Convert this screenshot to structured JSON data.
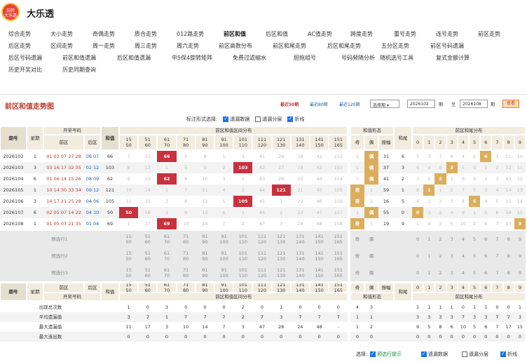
{
  "brand": {
    "logo_text": "玩转\n大乐透",
    "title": "大乐透"
  },
  "nav": [
    [
      "综合走势",
      "大小走势",
      "奇偶走势",
      "质合走势",
      "012路走势",
      "前区和值",
      "后区和值",
      "AC值走势",
      "跨度走势",
      "重号走势",
      "连号走势",
      "前区走势"
    ],
    [
      "后区走势",
      "区间走势",
      "周一走势",
      "周三走势",
      "周六走势",
      "前区高数分布",
      "前区和尾走势",
      "后区和尾走势",
      "五分区走势",
      "前区号码遗漏"
    ],
    [
      "后区号码遗漏",
      "前区和值遗漏",
      "后区和值遗漏",
      "中5保4旋转矩阵",
      "免费过滤缩水",
      "胆拖组号",
      "号码频随分析",
      "随机选号工具",
      "复式金额计算"
    ],
    [
      "历史开奖对比",
      "历史同期查询"
    ]
  ],
  "panel": {
    "title": "前区和值走势图",
    "latest50": "最近50期",
    "latest80": "最近80期",
    "latest120": "最近120期",
    "select": "选择期",
    "from": "2026102",
    "to": "2026108",
    "qi": "期",
    "zhi": "至",
    "view": "查看"
  },
  "opts": {
    "label": "标注形式选择:",
    "items": [
      "遗漏数据",
      "遗漏分层",
      "折线"
    ],
    "checked": [
      true,
      false,
      true
    ]
  },
  "header": {
    "period": "期号",
    "week": "星期",
    "draw": "开奖号码",
    "front": "前区",
    "back": "后区",
    "sum": "和值",
    "dist": "前区和值区间分布",
    "form": "和值形态",
    "odd": "奇",
    "even": "偶",
    "swing": "振幅",
    "tail": "和尾",
    "taildist": "前区和尾分布"
  },
  "ranges": [
    [
      "15",
      "50"
    ],
    [
      "51",
      "60"
    ],
    [
      "61",
      "70"
    ],
    [
      "71",
      "80"
    ],
    [
      "81",
      "90"
    ],
    [
      "91",
      "100"
    ],
    [
      "101",
      "110"
    ],
    [
      "111",
      "120"
    ],
    [
      "121",
      "130"
    ],
    [
      "131",
      "140"
    ],
    [
      "141",
      "150"
    ],
    [
      "151",
      "165"
    ]
  ],
  "tails": [
    "0",
    "1",
    "2",
    "3",
    "4",
    "5",
    "6",
    "7",
    "8",
    "9"
  ],
  "rows": [
    {
      "period": "2026102",
      "week": "1",
      "front": "01 03 07 27 28",
      "back": "06 07",
      "sum": "66",
      "dist": [
        "7",
        "11",
        "66",
        "4",
        "8",
        "1",
        "3",
        "41",
        "26",
        "18",
        "42",
        "152"
      ],
      "hit": 2,
      "odd": "1",
      "even": "偶",
      "oddhit": false,
      "swing": "31",
      "tail": "6",
      "tails": [
        "5",
        "3",
        "7",
        "6",
        "4",
        "2",
        "6",
        "1",
        "11",
        "10"
      ],
      "thit": 6
    },
    {
      "period": "2026103",
      "week": "3",
      "front": "03 16 17 32 35",
      "back": "02 12",
      "sum": "103",
      "dist": [
        "8",
        "12",
        "1",
        "5",
        "9",
        "2",
        "103",
        "42",
        "27",
        "19",
        "43",
        "153"
      ],
      "hit": 6,
      "odd": "1",
      "even": "偶",
      "oddhit": false,
      "swing": "37",
      "tail": "3",
      "tails": [
        "6",
        "4",
        "8",
        "3",
        "5",
        "3",
        "1",
        "2",
        "12",
        "11"
      ],
      "thit": 3
    },
    {
      "period": "2026104",
      "week": "6",
      "front": "01 06 14 15 26",
      "back": "08 09",
      "sum": "62",
      "dist": [
        "9",
        "13",
        "62",
        "6",
        "10",
        "3",
        "1",
        "43",
        "28",
        "20",
        "44",
        "154"
      ],
      "hit": 2,
      "odd": "1",
      "even": "偶",
      "oddhit": false,
      "swing": "41",
      "tail": "2",
      "tails": [
        "7",
        "5",
        "2",
        "1",
        "6",
        "4",
        "2",
        "3",
        "13",
        "12"
      ],
      "thit": 2
    },
    {
      "period": "2026105",
      "week": "1",
      "front": "10 14 30 33 34",
      "back": "09 12",
      "sum": "121",
      "dist": [
        "10",
        "14",
        "1",
        "7",
        "11",
        "4",
        "2",
        "44",
        "121",
        "21",
        "45",
        "155"
      ],
      "hit": 8,
      "odd": "奇",
      "even": "1",
      "oddhit": true,
      "swing": "59",
      "tail": "1",
      "tails": [
        "8",
        "1",
        "1",
        "2",
        "7",
        "5",
        "3",
        "4",
        "14",
        "13"
      ],
      "thit": 1
    },
    {
      "period": "2026106",
      "week": "3",
      "front": "14 17 21 25 28",
      "back": "04 06",
      "sum": "105",
      "dist": [
        "11",
        "15",
        "2",
        "8",
        "12",
        "5",
        "105",
        "45",
        "1",
        "22",
        "46",
        "156"
      ],
      "hit": 6,
      "odd": "奇",
      "even": "2",
      "oddhit": true,
      "swing": "16",
      "tail": "5",
      "tails": [
        "9",
        "2",
        "2",
        "3",
        "8",
        "5",
        "4",
        "5",
        "15",
        "14"
      ],
      "thit": 5
    },
    {
      "period": "2026107",
      "week": "6",
      "front": "02 05 07 14 22",
      "back": "04 10",
      "sum": "50",
      "dist": [
        "50",
        "16",
        "3",
        "9",
        "13",
        "6",
        "1",
        "46",
        "2",
        "23",
        "47",
        "157"
      ],
      "hit": 0,
      "odd": "1",
      "even": "偶",
      "oddhit": false,
      "swing": "55",
      "tail": "0",
      "tails": [
        "0",
        "3",
        "2",
        "4",
        "9",
        "1",
        "5",
        "6",
        "16",
        "15"
      ],
      "thit": 0
    },
    {
      "period": "2026108",
      "week": "1",
      "front": "01 05 07 21 35",
      "back": "01 04",
      "sum": "69",
      "dist": [
        "1",
        "17",
        "69",
        "10",
        "14",
        "7",
        "2",
        "47",
        "3",
        "24",
        "48",
        "158"
      ],
      "hit": 2,
      "odd": "奇",
      "even": "1",
      "oddhit": true,
      "swing": "19",
      "tail": "9",
      "tails": [
        "1",
        "4",
        "3",
        "5",
        "10",
        "2",
        "6",
        "7",
        "17",
        "9"
      ],
      "thit": 9
    }
  ],
  "preds": [
    "预选行1",
    "预选行2",
    "预选行3"
  ],
  "stats": [
    {
      "label": "出现总次数",
      "dist": [
        "1",
        "0",
        "3",
        "0",
        "0",
        "0",
        "2",
        "0",
        "1",
        "0",
        "0",
        "0"
      ],
      "form": [
        "4",
        "3"
      ],
      "tails": [
        "1",
        "1",
        "1",
        "1",
        "0",
        "1",
        "1",
        "0",
        "0",
        "1"
      ]
    },
    {
      "label": "平均遗漏值",
      "dist": [
        "3",
        "7",
        "1",
        "7",
        "7",
        "7",
        "2",
        "7",
        "3",
        "7",
        "7",
        "7"
      ],
      "form": [
        "1",
        "1"
      ],
      "tails": [
        "3",
        "3",
        "3",
        "3",
        "7",
        "3",
        "3",
        "7",
        "7",
        "3"
      ]
    },
    {
      "label": "最大遗漏值",
      "dist": [
        "11",
        "17",
        "3",
        "10",
        "14",
        "7",
        "3",
        "47",
        "28",
        "24",
        "48",
        "-"
      ],
      "form": [
        "1",
        "2"
      ],
      "tails": [
        "9",
        "5",
        "8",
        "6",
        "10",
        "5",
        "6",
        "7",
        "17",
        "15"
      ]
    },
    {
      "label": "最大连出数",
      "dist": [
        "0",
        "0",
        "0",
        "0",
        "0",
        "0",
        "0",
        "0",
        "0",
        "0",
        "0",
        "0"
      ],
      "form": [
        "0",
        "0"
      ],
      "tails": [
        "0",
        "0",
        "0",
        "0",
        "0",
        "0",
        "0",
        "0",
        "0",
        "0"
      ]
    }
  ],
  "footer": {
    "label": "选择:",
    "items": [
      "预选行提示",
      "遗漏数据",
      "遗漏分层",
      "折线"
    ],
    "checked": [
      true,
      true,
      false,
      true
    ]
  }
}
